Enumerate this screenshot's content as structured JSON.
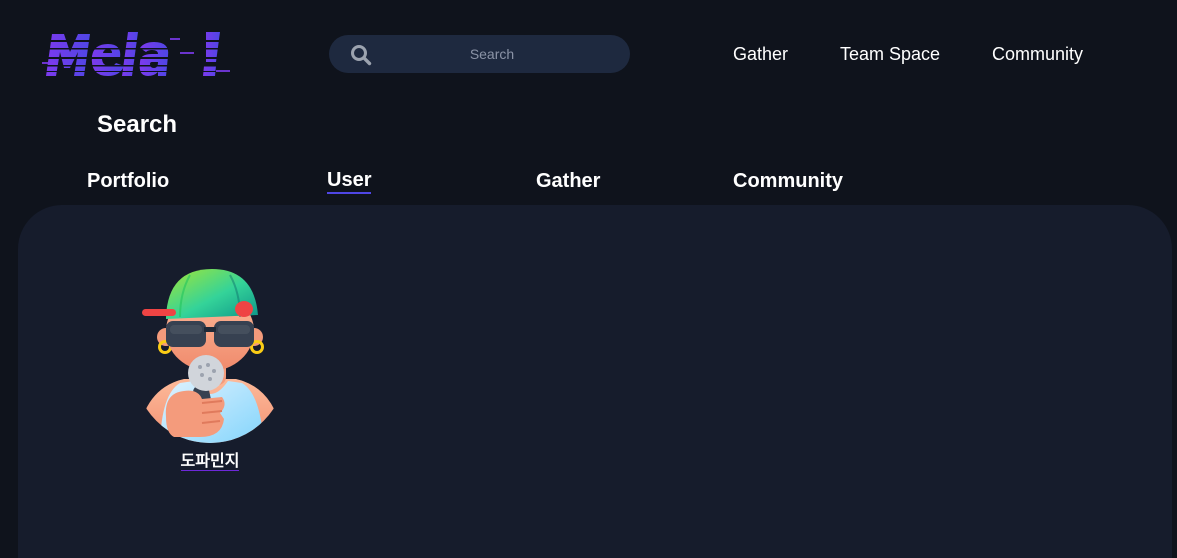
{
  "brand": {
    "logo_text": "Mela!",
    "accent_color": "#5b3df5"
  },
  "search": {
    "placeholder": "Search",
    "value": ""
  },
  "top_nav": {
    "items": [
      {
        "label": "Gather"
      },
      {
        "label": "Team Space"
      },
      {
        "label": "Community"
      }
    ]
  },
  "page": {
    "title": "Search"
  },
  "tabs": {
    "items": [
      {
        "label": "Portfolio"
      },
      {
        "label": "User",
        "active": true
      },
      {
        "label": "Gather"
      },
      {
        "label": "Community"
      }
    ]
  },
  "results": {
    "users": [
      {
        "name": "도파민지",
        "avatar_icon": "rapper-avatar-icon"
      }
    ]
  },
  "colors": {
    "background": "#0f131c",
    "panel": "#161c2c",
    "search_bg": "#1e293f",
    "active_tab_underline": "#4f46e5"
  }
}
